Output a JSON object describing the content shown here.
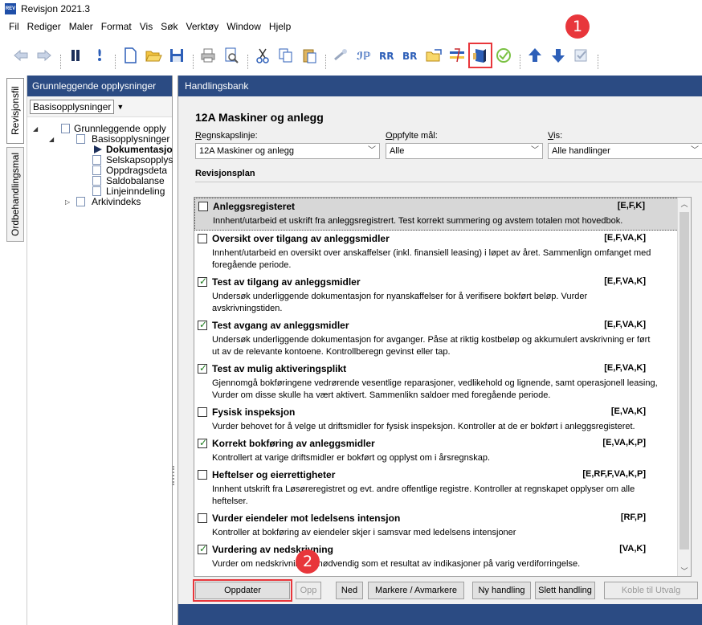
{
  "window": {
    "title": "Revisjon 2021.3",
    "icon_text": "REV"
  },
  "menu": [
    "Fil",
    "Rediger",
    "Maler",
    "Format",
    "Vis",
    "Søk",
    "Verktøy",
    "Window",
    "Hjelp"
  ],
  "toolbar_icons": [
    "back-arrow-icon",
    "forward-arrow-icon",
    "pause-icon",
    "info-icon",
    "new-document-icon",
    "open-folder-icon",
    "save-icon",
    "print-icon",
    "print-preview-icon",
    "cut-icon",
    "copy-icon",
    "paste-icon",
    "link-icon",
    "column-icon",
    "rr-icon",
    "br-icon",
    "export-folder-icon",
    "sort-icon",
    "bank-book-icon",
    "approve-check-icon",
    "move-up-icon",
    "move-down-icon",
    "checklist-icon"
  ],
  "annotations": {
    "badge1": "1",
    "badge2": "2"
  },
  "vertical_tabs": [
    "Revisjonsfil",
    "Ordbehandlingsmal"
  ],
  "left_pane": {
    "header": "Grunnleggende opplysninger",
    "combo": "Basisopplysninger",
    "tree": [
      {
        "label": "Grunnleggende opply",
        "expand": "◢",
        "level": 0,
        "bold": false,
        "icon": "doc"
      },
      {
        "label": "Basisopplysninger",
        "expand": "◢",
        "level": 1,
        "bold": false,
        "icon": "doc"
      },
      {
        "label": "Dokumentasjo",
        "expand": "",
        "level": 2,
        "bold": true,
        "icon": "play"
      },
      {
        "label": "Selskapsopplys",
        "expand": "",
        "level": 2,
        "bold": false,
        "icon": "doc"
      },
      {
        "label": "Oppdragsdeta",
        "expand": "",
        "level": 2,
        "bold": false,
        "icon": "doc"
      },
      {
        "label": "Saldobalanse",
        "expand": "",
        "level": 2,
        "bold": false,
        "icon": "doc"
      },
      {
        "label": "Linjeinndeling",
        "expand": "",
        "level": 2,
        "bold": false,
        "icon": "doc"
      },
      {
        "label": "Arkivindeks",
        "expand": "▷",
        "level": 1,
        "bold": false,
        "icon": "doc"
      }
    ]
  },
  "main": {
    "header": "Handlingsbank",
    "section_title": "12A Maskiner og anlegg",
    "fields": {
      "regnskapslinje": {
        "label_hot": "R",
        "label_rest": "egnskapslinje:",
        "value": "12A Maskiner og anlegg"
      },
      "oppfylte_mal": {
        "label_hot": "O",
        "label_rest": "ppfylte mål:",
        "value": "Alle"
      },
      "vis": {
        "label_hot": "V",
        "label_rest": "is:",
        "value": "Alle handlinger"
      }
    },
    "subsection": "Revisjonsplan",
    "items": [
      {
        "name": "Anleggsregisteret",
        "codes": "[E,F,K]",
        "checked": false,
        "selected": true,
        "desc": "Innhent/utarbeid et uskrift fra anleggsregistrert. Test korrekt summering og avstem totalen mot hovedbok."
      },
      {
        "name": "Oversikt over tilgang av anleggsmidler",
        "codes": "[E,F,VA,K]",
        "checked": false,
        "selected": false,
        "desc": "Innhent/utarbeid en oversikt over anskaffelser (inkl. finansiell leasing) i løpet av året. Sammenlign omfanget med foregående periode."
      },
      {
        "name": "Test av tilgang av anleggsmidler",
        "codes": "[E,F,VA,K]",
        "checked": true,
        "selected": false,
        "desc": "Undersøk underliggende dokumentasjon for nyanskaffelser for å verifisere bokført beløp. Vurder avskrivningstiden."
      },
      {
        "name": "Test avgang av anleggsmidler",
        "codes": "[E,F,VA,K]",
        "checked": true,
        "selected": false,
        "desc": "Undersøk underliggende dokumentasjon for avganger. Påse at riktig kostbeløp og akkumulert avskrivning er ført ut av de relevante kontoene. Kontrollberegn gevinst eller tap."
      },
      {
        "name": "Test av mulig aktiveringsplikt",
        "codes": "[E,F,VA,K]",
        "checked": true,
        "selected": false,
        "desc": "Gjennomgå bokføringene vedrørende vesentlige reparasjoner, vedlikehold og lignende, samt operasjonell leasing, Vurder om disse skulle ha vært aktivert. Sammenlikn saldoer med foregående periode."
      },
      {
        "name": "Fysisk inspeksjon",
        "codes": "[E,VA,K]",
        "checked": false,
        "selected": false,
        "desc": "Vurder behovet for å velge ut driftsmidler for fysisk inspeksjon. Kontroller at de er bokført i anleggsregisteret."
      },
      {
        "name": "Korrekt bokføring av anleggsmidler",
        "codes": "[E,VA,K,P]",
        "checked": true,
        "selected": false,
        "desc": "Kontrollert at varige driftsmidler er bokført og opplyst om i årsregnskap."
      },
      {
        "name": "Heftelser og eierrettigheter",
        "codes": "[E,RF,F,VA,K,P]",
        "checked": false,
        "selected": false,
        "desc": "Innhent utskrift fra Løsøreregistret og evt. andre offentlige registre. Kontroller at regnskapet opplyser om alle heftelser."
      },
      {
        "name": "Vurder eiendeler mot ledelsens intensjon",
        "codes": "[RF,P]",
        "checked": false,
        "selected": false,
        "desc": "Kontroller at bokføring av eiendeler skjer i samsvar med ledelsens intensjoner"
      },
      {
        "name": "Vurdering av nedskrivning",
        "codes": "[VA,K]",
        "checked": true,
        "selected": false,
        "desc": "Vurder om nedskrivning er nødvendig som et resultat av indikasjoner på varig verdiforringelse."
      }
    ],
    "buttons": {
      "oppdater": "Oppdater",
      "opp": "Opp",
      "ned": "Ned",
      "markere": "Markere / Avmarkere",
      "ny_handling": "Ny handling",
      "slett_handling": "Slett handling",
      "koble": "Koble til Utvalg"
    }
  }
}
